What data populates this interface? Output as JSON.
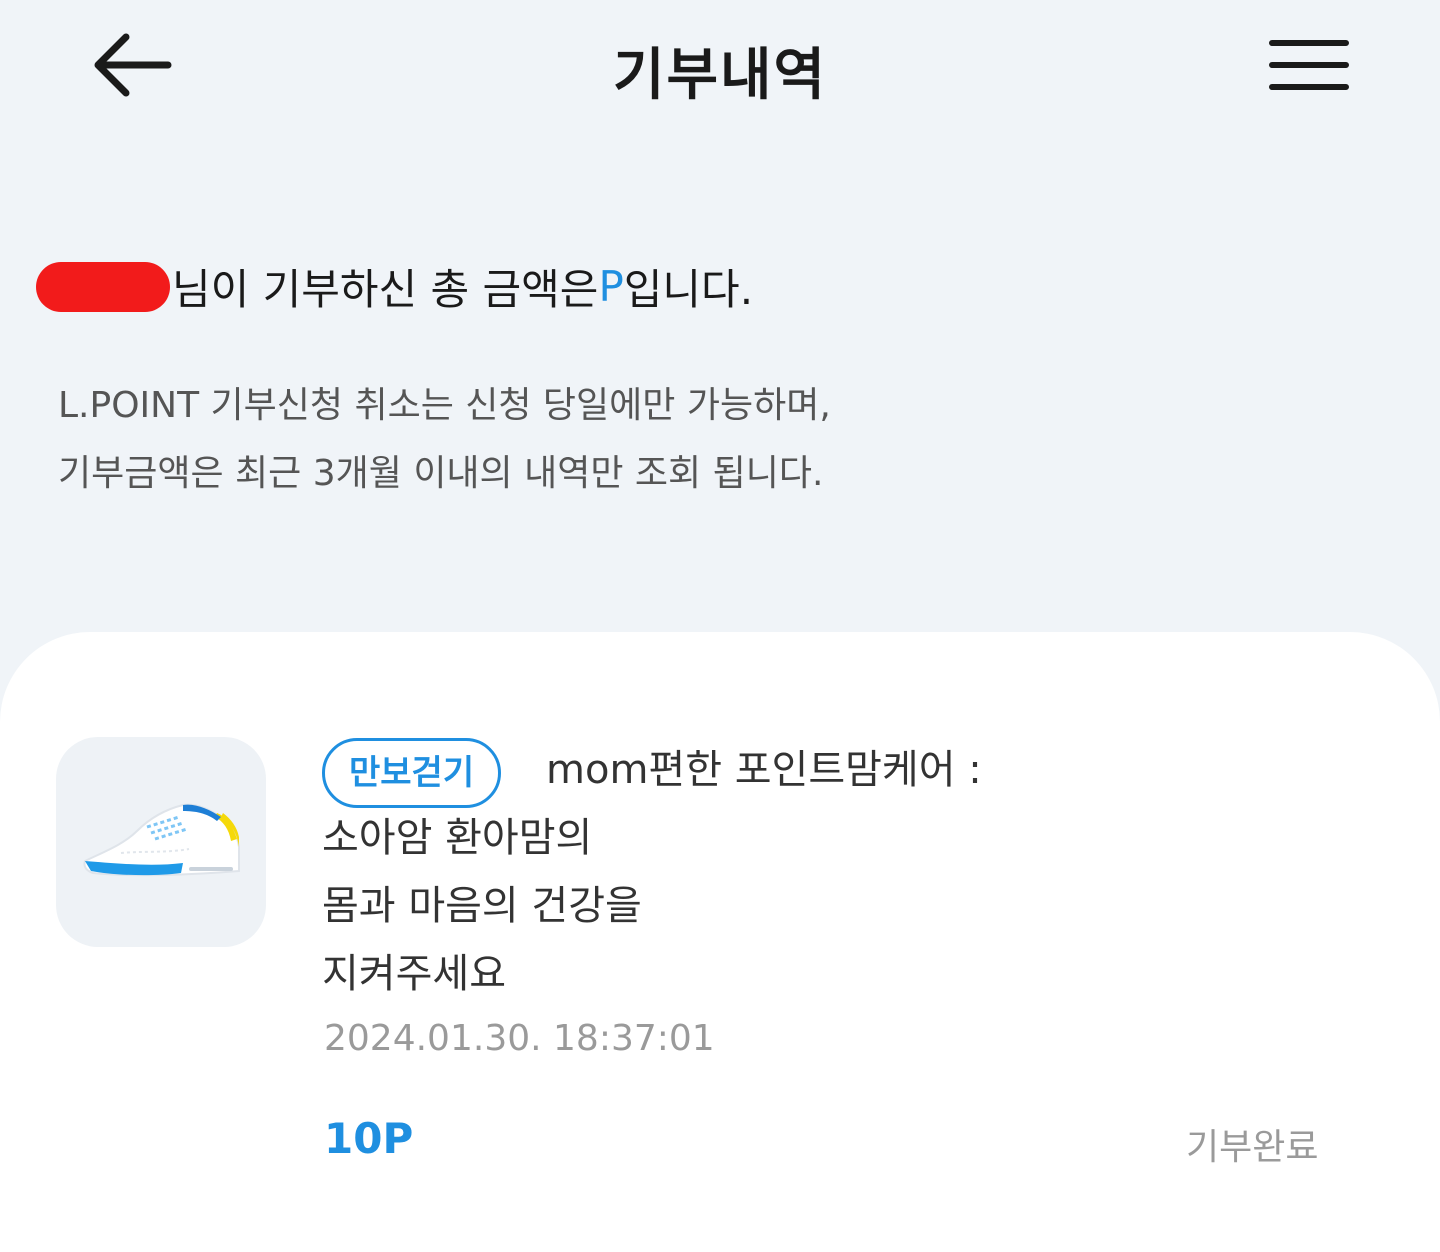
{
  "header": {
    "title": "기부내역",
    "back_icon": "arrow-left-icon",
    "menu_icon": "hamburger-menu-icon"
  },
  "summary": {
    "text_before_amount": "님이 기부하신 총 금액은",
    "amount_unit": "P",
    "text_after_amount": "입니다."
  },
  "notice": {
    "line1": "L.POINT 기부신청 취소는 신청 당일에만 가능하며,",
    "line2": "기부금액은 최근 3개월 이내의 내역만 조회 됩니다."
  },
  "donation": {
    "thumbnail_icon": "sneaker-icon",
    "tag": "만보걷기",
    "title_line1": "mom편한 포인트맘케어 :",
    "title_line2": "소아암 환아맘의",
    "title_line3": "몸과 마음의 건강을",
    "title_line4": "지켜주세요",
    "date": "2024.01.30. 18:37:01",
    "points": "10P",
    "status": "기부완료"
  },
  "colors": {
    "accent": "#1f8fe0",
    "background": "#f0f4f8",
    "card": "#ffffff",
    "redaction": "#f21b1b"
  }
}
